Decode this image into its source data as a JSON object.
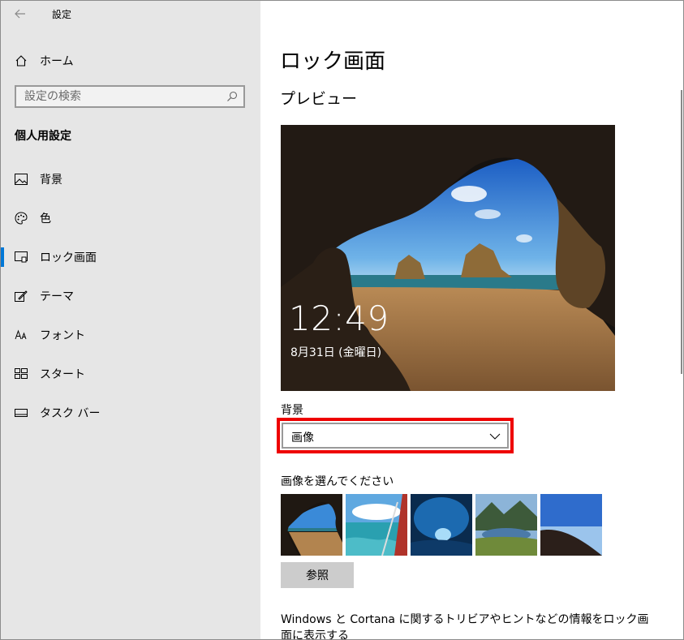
{
  "window": {
    "title": "設定"
  },
  "sidebar": {
    "home_label": "ホーム",
    "search_placeholder": "設定の検索",
    "section_title": "個人用設定",
    "items": [
      {
        "label": "背景",
        "icon": "picture-icon"
      },
      {
        "label": "色",
        "icon": "palette-icon"
      },
      {
        "label": "ロック画面",
        "icon": "lock-screen-icon",
        "active": true
      },
      {
        "label": "テーマ",
        "icon": "theme-brush-icon"
      },
      {
        "label": "フォント",
        "icon": "font-icon"
      },
      {
        "label": "スタート",
        "icon": "start-icon"
      },
      {
        "label": "タスク バー",
        "icon": "taskbar-icon"
      }
    ]
  },
  "content": {
    "page_title": "ロック画面",
    "preview_title": "プレビュー",
    "preview": {
      "time": "12:49",
      "date": "8月31日 (金曜日)"
    },
    "background_label": "背景",
    "background_value": "画像",
    "choose_label": "画像を選んでください",
    "browse_label": "参照",
    "spotlight_text": "Windows と Cortana に関するトリビアやヒントなどの情報をロック画面に表示する"
  },
  "colors": {
    "accent": "#0078d7",
    "highlight": "#e00000",
    "sidebar_bg": "#e6e6e6"
  }
}
